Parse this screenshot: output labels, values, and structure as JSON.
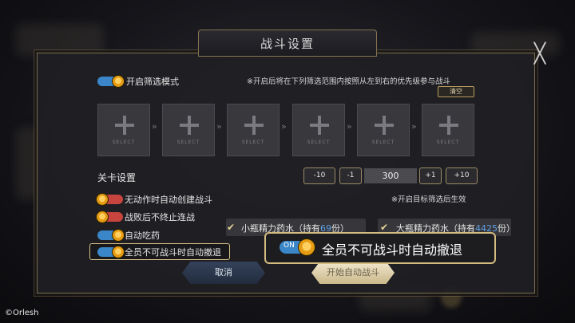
{
  "dialog": {
    "title": "战斗设置",
    "close_glyph": "╳"
  },
  "filter_mode": {
    "label": "开启筛选模式",
    "toggle_on": true,
    "note": "※开启后将在下列筛选范围内按照从左到右的优先级参与战斗",
    "clear_label": "清空"
  },
  "slots": [
    {
      "label": "SELECT"
    },
    {
      "label": "SELECT"
    },
    {
      "label": "SELECT"
    },
    {
      "label": "SELECT"
    },
    {
      "label": "SELECT"
    },
    {
      "label": "SELECT"
    }
  ],
  "chevron_glyph": "»",
  "stage": {
    "label": "关卡设置",
    "buttons": [
      "-10",
      "-1",
      "+1",
      "+10"
    ],
    "value": "300",
    "note": "※开启目标筛选后生效"
  },
  "options": [
    {
      "label": "无动作时自动创建战斗",
      "on": false
    },
    {
      "label": "战败后不终止连战",
      "on": false
    },
    {
      "label": "自动吃药",
      "on": true
    },
    {
      "label": "全员不可战斗时自动撤退",
      "on": true
    }
  ],
  "potions": [
    {
      "prefix": "小瓶精力药水（持有",
      "count": "69",
      "suffix": "份）"
    },
    {
      "prefix": "大瓶精力药水（持有",
      "count": "4425",
      "suffix": "份）"
    }
  ],
  "check_glyph": "✔",
  "buttons": {
    "cancel": "取消",
    "start": "开始自动战斗"
  },
  "callout": {
    "toggle_text": "ON",
    "text": "全员不可战斗时自动撤退"
  },
  "copyright": "©Orlesh",
  "colors": {
    "toggle_on": "#3a86c8",
    "toggle_off": "#c8443e",
    "accent_gold": "#d4bb80",
    "potion_count": "#5fa0e6"
  }
}
